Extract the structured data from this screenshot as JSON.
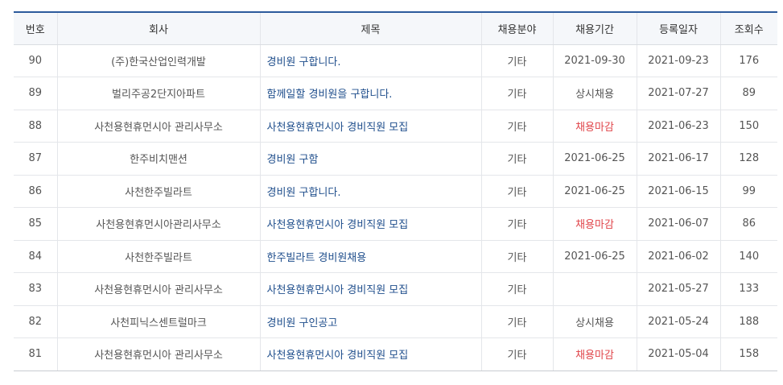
{
  "table": {
    "headers": [
      "번호",
      "회사",
      "제목",
      "채용분야",
      "채용기간",
      "등록일자",
      "조회수"
    ],
    "rows": [
      {
        "no": "90",
        "company": "(주)한국산업인력개발",
        "title": "경비원 구합니다.",
        "field": "기타",
        "period": "2021-09-30",
        "period_status": "open",
        "date": "2021-09-23",
        "views": "176"
      },
      {
        "no": "89",
        "company": "벌리주공2단지아파트",
        "title": "함께일할 경비원을 구합니다.",
        "field": "기타",
        "period": "상시채용",
        "period_status": "open",
        "date": "2021-07-27",
        "views": "89"
      },
      {
        "no": "88",
        "company": "사천용현휴먼시아 관리사무소",
        "title": "사천용현휴먼시아 경비직원 모집",
        "field": "기타",
        "period": "채용마감",
        "period_status": "closed",
        "date": "2021-06-23",
        "views": "150"
      },
      {
        "no": "87",
        "company": "한주비치맨션",
        "title": "경비원 구함",
        "field": "기타",
        "period": "2021-06-25",
        "period_status": "open",
        "date": "2021-06-17",
        "views": "128"
      },
      {
        "no": "86",
        "company": "사천한주빌라트",
        "title": "경비원 구합니다.",
        "field": "기타",
        "period": "2021-06-25",
        "period_status": "open",
        "date": "2021-06-15",
        "views": "99"
      },
      {
        "no": "85",
        "company": "사천용현휴먼시아관리사무소",
        "title": "사천용현휴먼시아 경비직원 모집",
        "field": "기타",
        "period": "채용마감",
        "period_status": "closed",
        "date": "2021-06-07",
        "views": "86"
      },
      {
        "no": "84",
        "company": "사천한주빌라트",
        "title": "한주빌라트 경비원채용",
        "field": "기타",
        "period": "2021-06-25",
        "period_status": "open",
        "date": "2021-06-02",
        "views": "140"
      },
      {
        "no": "83",
        "company": "사천용현휴먼시아 관리사무소",
        "title": "사천용현휴먼시아 경비직원 모집",
        "field": "기타",
        "period": "",
        "period_status": "open",
        "date": "2021-05-27",
        "views": "133"
      },
      {
        "no": "82",
        "company": "사천피닉스센트럴마크",
        "title": "경비원 구인공고",
        "field": "기타",
        "period": "상시채용",
        "period_status": "open",
        "date": "2021-05-24",
        "views": "188"
      },
      {
        "no": "81",
        "company": "사천용현휴먼시아 관리사무소",
        "title": "사천용현휴먼시아 경비직원 모집",
        "field": "기타",
        "period": "채용마감",
        "period_status": "closed",
        "date": "2021-05-04",
        "views": "158"
      }
    ]
  },
  "colors": {
    "header_top_border": "#2c5a9c",
    "header_bg": "#f5f7fa",
    "title_link": "#1f4e8c",
    "closed_status": "#e0454a"
  }
}
